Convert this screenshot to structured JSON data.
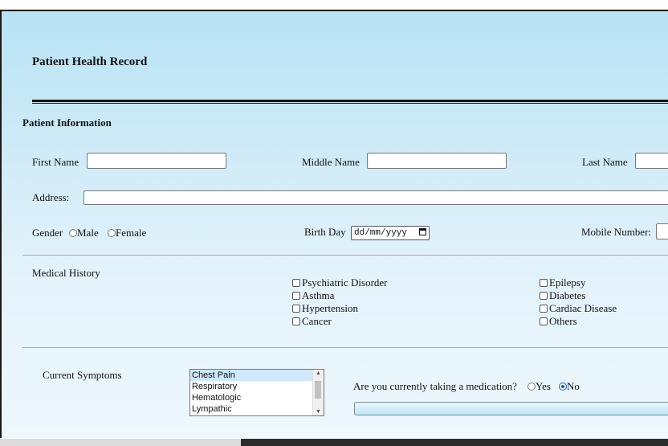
{
  "form": {
    "title": "Patient Health Record",
    "section_title": "Patient Information",
    "first_name_label": "First Name",
    "first_name_value": "",
    "middle_name_label": "Middle Name",
    "middle_name_value": "",
    "last_name_label": "Last Name",
    "last_name_value": "",
    "address_label": "Address:",
    "address_value": "",
    "gender_label": "Gender",
    "gender_options": [
      "Male",
      "Female"
    ],
    "birthday_label": "Birth Day",
    "birthday_placeholder": "dd/mm/yyyy",
    "mobile_label": "Mobile Number:",
    "mobile_value": ""
  },
  "medical_history": {
    "label": "Medical History",
    "column1": [
      "Psychiatric Disorder",
      "Asthma",
      "Hypertension",
      "Cancer"
    ],
    "column2": [
      "Epilepsy",
      "Diabetes",
      "Cardiac Disease",
      "Others"
    ]
  },
  "symptoms": {
    "label": "Current Symptoms",
    "options": [
      "Chest Pain",
      "Respiratory",
      "Hematologic",
      "Lympathic"
    ],
    "selected": "Chest Pain"
  },
  "medication": {
    "question": "Are you currently taking a medication?",
    "yes_label": "Yes",
    "no_label": "No",
    "selected": "No"
  },
  "colors": {
    "background_top": "#b7e3f5",
    "background_bottom": "#eef8fd",
    "radio_selected": "#0a5ecf"
  }
}
